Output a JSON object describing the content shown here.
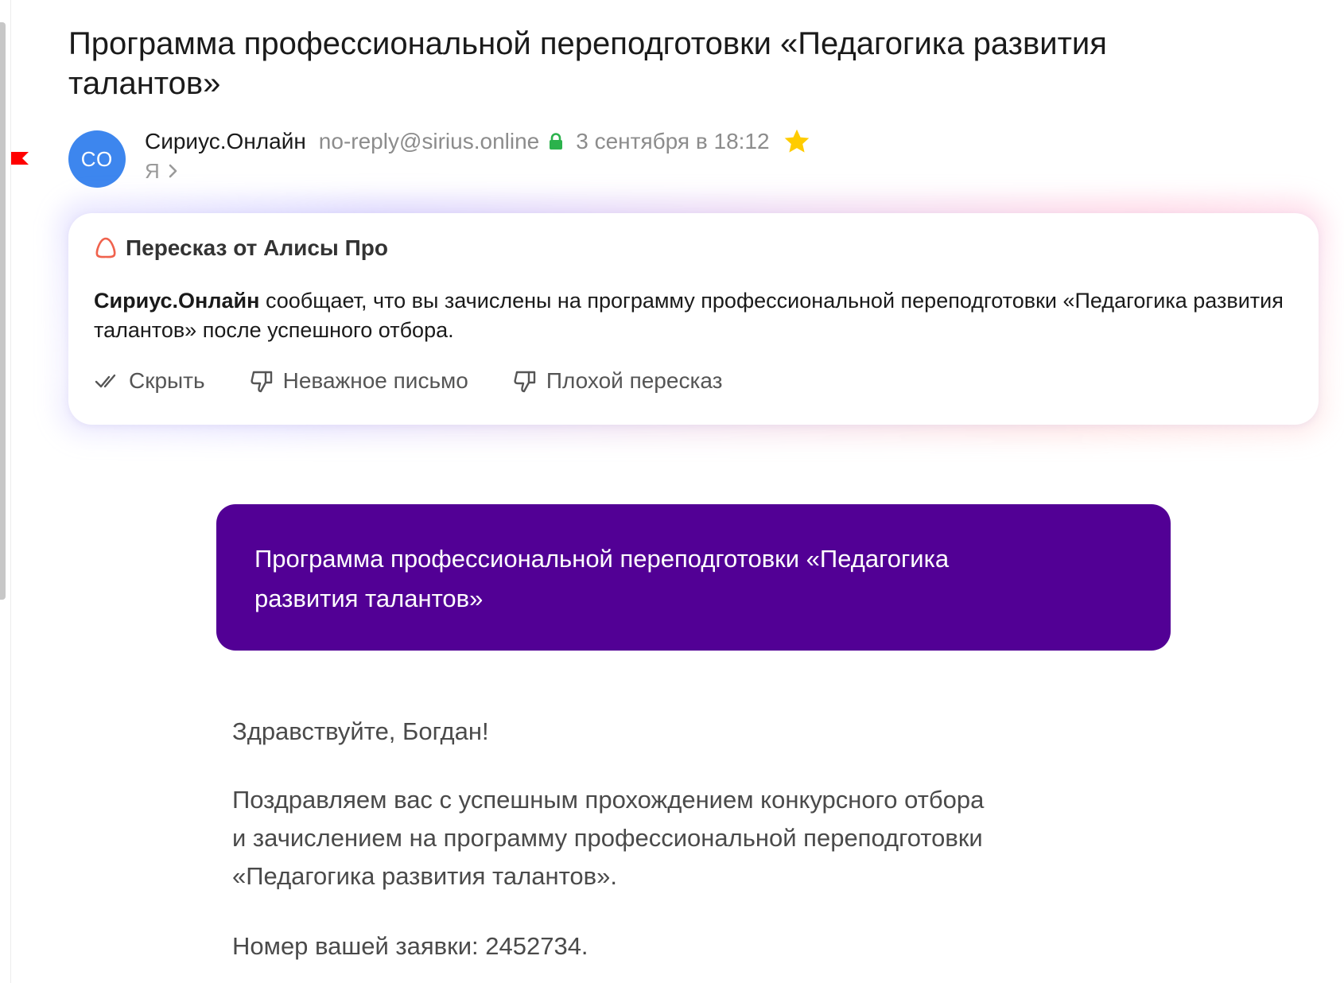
{
  "email": {
    "subject": "Программа профессиональной переподготовки «Педагогика развития талантов»",
    "avatar_initials": "СО",
    "sender_name": "Сириус.Онлайн",
    "sender_email": "no-reply@sirius.online",
    "date": "3 сентября в 18:12",
    "recipient": "Я"
  },
  "summary": {
    "title": "Пересказ от Алисы Про",
    "sender_bold": "Сириус.Онлайн",
    "text": " сообщает, что вы зачислены на программу профессиональной переподготовки «Педагогика развития талантов» после успешного отбора.",
    "actions": [
      {
        "label": "Скрыть",
        "icon": "double-check-icon"
      },
      {
        "label": "Неважное письмо",
        "icon": "thumbs-down-icon"
      },
      {
        "label": "Плохой пересказ",
        "icon": "thumbs-down-icon"
      }
    ]
  },
  "body": {
    "banner_title": "Программа профессиональной переподготовки «Педагогика развития талантов»",
    "greeting": "Здравствуйте, Богдан!",
    "paragraph_lines": [
      "Поздравляем вас с успешным прохождением конкурсного отбора",
      "и зачислением на программу профессиональной переподготовки",
      "«Педагогика развития талантов»."
    ],
    "application_number": "Номер вашей заявки: 2452734."
  },
  "colors": {
    "avatar": "#3d86ee",
    "banner": "#520095",
    "flag": "#ff0000",
    "lock": "#2bb24c",
    "star": "#ffcc00"
  }
}
